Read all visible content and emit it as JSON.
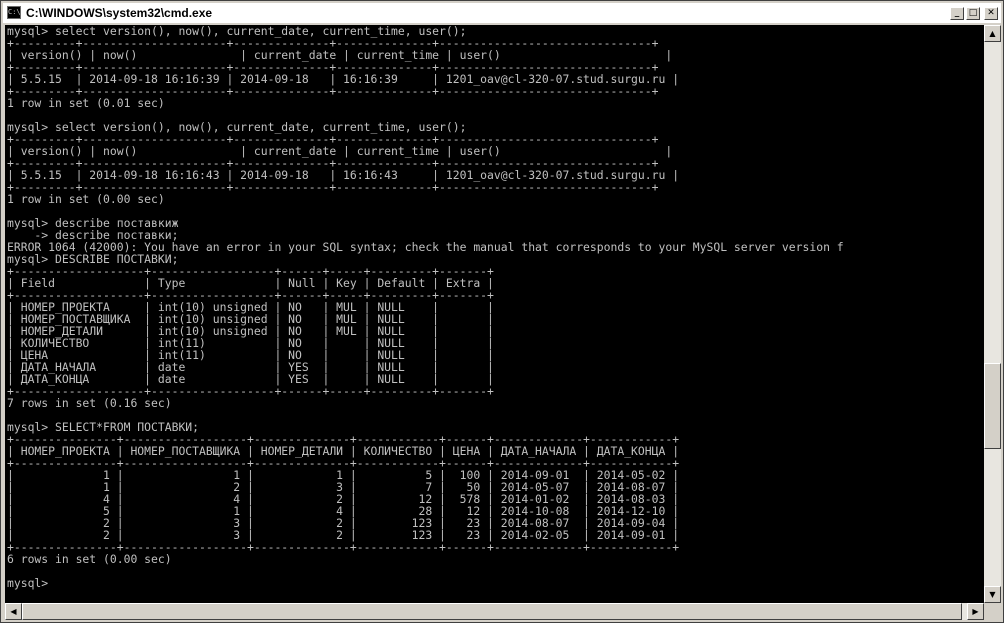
{
  "window": {
    "title": "C:\\WINDOWS\\system32\\cmd.exe",
    "icon_label": "C:\\"
  },
  "caption_buttons": {
    "minimize": "_",
    "maximize": "□",
    "close": "✕"
  },
  "console": {
    "lines": [
      "mysql> select version(), now(), current_date, current_time, user();",
      "+---------+---------------------+--------------+--------------+-------------------------------+",
      "| version() | now()               | current_date | current_time | user()                        |",
      "+---------+---------------------+--------------+--------------+-------------------------------+",
      "| 5.5.15  | 2014-09-18 16:16:39 | 2014-09-18   | 16:16:39     | 1201_oav@cl-320-07.stud.surgu.ru |",
      "+---------+---------------------+--------------+--------------+-------------------------------+",
      "1 row in set (0.01 sec)",
      "",
      "mysql> select version(), now(), current_date, current_time, user();",
      "+---------+---------------------+--------------+--------------+-------------------------------+",
      "| version() | now()               | current_date | current_time | user()                        |",
      "+---------+---------------------+--------------+--------------+-------------------------------+",
      "| 5.5.15  | 2014-09-18 16:16:43 | 2014-09-18   | 16:16:43     | 1201_oav@cl-320-07.stud.surgu.ru |",
      "+---------+---------------------+--------------+--------------+-------------------------------+",
      "1 row in set (0.00 sec)",
      "",
      "mysql> describe поставкиж",
      "    -> describe поставки;",
      "ERROR 1064 (42000): You have an error in your SQL syntax; check the manual that corresponds to your MySQL server version f",
      "mysql> DESCRIBE ПОСТАВКИ;",
      "+-------------------+------------------+------+-----+---------+-------+",
      "| Field             | Type             | Null | Key | Default | Extra |",
      "+-------------------+------------------+------+-----+---------+-------+",
      "| НОМЕР_ПРОЕКТА     | int(10) unsigned | NO   | MUL | NULL    |       |",
      "| НОМЕР_ПОСТАВЩИКА  | int(10) unsigned | NO   | MUL | NULL    |       |",
      "| НОМЕР_ДЕТАЛИ      | int(10) unsigned | NO   | MUL | NULL    |       |",
      "| КОЛИЧЕСТВО        | int(11)          | NO   |     | NULL    |       |",
      "| ЦЕНА              | int(11)          | NO   |     | NULL    |       |",
      "| ДАТА_НАЧАЛА       | date             | YES  |     | NULL    |       |",
      "| ДАТА_КОНЦА        | date             | YES  |     | NULL    |       |",
      "+-------------------+------------------+------+-----+---------+-------+",
      "7 rows in set (0.16 sec)",
      "",
      "mysql> SELECT*FROM ПОСТАВКИ;",
      "+---------------+------------------+--------------+------------+------+-------------+------------+",
      "| НОМЕР_ПРОЕКТА | НОМЕР_ПОСТАВЩИКА | НОМЕР_ДЕТАЛИ | КОЛИЧЕСТВО | ЦЕНА | ДАТА_НАЧАЛА | ДАТА_КОНЦА |",
      "+---------------+------------------+--------------+------------+------+-------------+------------+",
      "|             1 |                1 |            1 |          5 |  100 | 2014-09-01  | 2014-05-02 |",
      "|             1 |                2 |            3 |          7 |   50 | 2014-05-07  | 2014-08-07 |",
      "|             4 |                4 |            2 |         12 |  578 | 2014-01-02  | 2014-08-03 |",
      "|             5 |                1 |            4 |         28 |   12 | 2014-10-08  | 2014-12-10 |",
      "|             2 |                3 |            2 |        123 |   23 | 2014-08-07  | 2014-09-04 |",
      "|             2 |                3 |            2 |        123 |   23 | 2014-02-05  | 2014-09-01 |",
      "+---------------+------------------+--------------+------------+------+-------------+------------+",
      "6 rows in set (0.00 sec)",
      "",
      "mysql>"
    ]
  },
  "scrollbars": {
    "vertical_position": 0.7,
    "horizontal_position": 0.0
  }
}
